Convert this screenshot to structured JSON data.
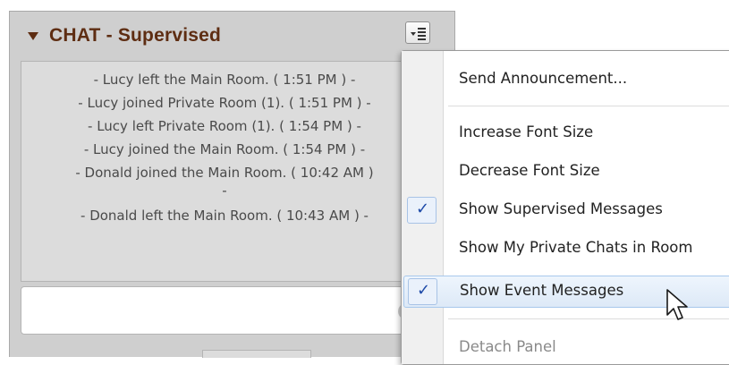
{
  "panel": {
    "title": "CHAT - Supervised",
    "messages": [
      "- Lucy left the Main Room. ( 1:51 PM ) -",
      "- Lucy joined Private Room (1). ( 1:51 PM ) -",
      "- Lucy left Private Room (1). ( 1:54 PM ) -",
      "- Lucy joined the Main Room. ( 1:54 PM ) -",
      "- Donald joined the Main Room. ( 10:42 AM )",
      "-",
      "- Donald left the Main Room. ( 10:43 AM ) -"
    ],
    "input_placeholder": ""
  },
  "menu": {
    "items": [
      {
        "label": "Send Announcement...",
        "checked": false,
        "disabled": false
      },
      {
        "label": "Increase Font Size",
        "checked": false,
        "disabled": false
      },
      {
        "label": "Decrease Font Size",
        "checked": false,
        "disabled": false
      },
      {
        "label": "Show Supervised Messages",
        "checked": true,
        "disabled": false
      },
      {
        "label": "Show My Private Chats in Room",
        "checked": false,
        "disabled": false
      },
      {
        "label": "Show Event Messages",
        "checked": true,
        "disabled": false,
        "hovered": true
      },
      {
        "label": "Detach Panel",
        "checked": false,
        "disabled": true
      }
    ],
    "check_glyph": "✓"
  },
  "colors": {
    "title": "#5e2d12",
    "panel_bg": "#cfcfcf",
    "message_text": "#4a4a4a",
    "check": "#1e4aa8",
    "hover_border": "#a8c8ec"
  }
}
